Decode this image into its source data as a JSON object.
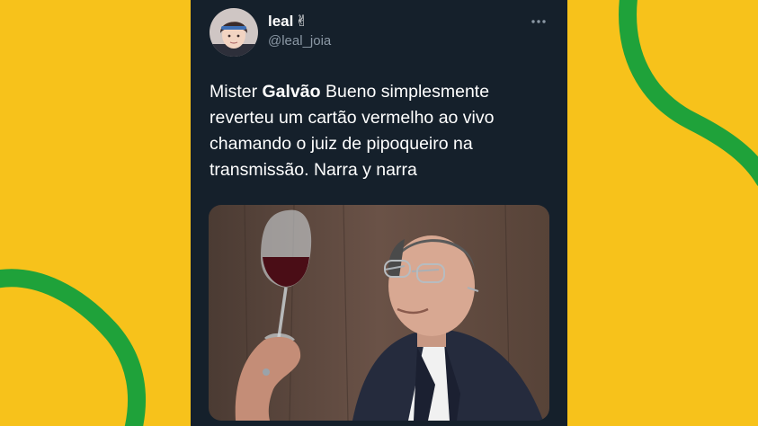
{
  "tweet": {
    "display_name": "leal",
    "name_emoji": "✌",
    "handle": "@leal_joia",
    "more_icon": "more-horizontal-icon",
    "text": {
      "part1": "Mister ",
      "bold": "Galvão",
      "part2": " Bueno simplesmente reverteu um cartão vermelho ao vivo chamando o juiz de pipoqueiro na transmissão. Narra y narra"
    }
  },
  "colors": {
    "background": "#f7c21b",
    "decor_green": "#1fa23a",
    "card": "#15202b",
    "text_primary": "#ffffff",
    "text_secondary": "#8b98a5"
  }
}
